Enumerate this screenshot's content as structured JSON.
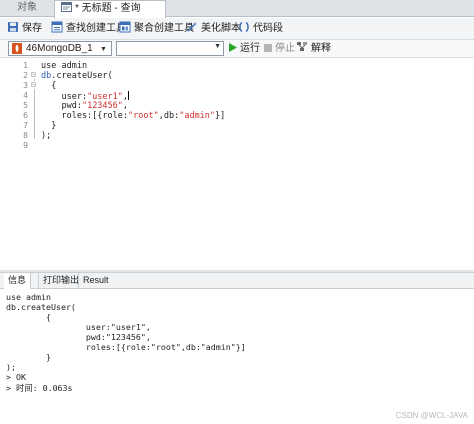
{
  "tabs": {
    "objects_label": "对象",
    "query_label": "* 无标题 - 查询"
  },
  "toolbar": {
    "save_label": "保存",
    "find_builder_label": "查找创建工具",
    "aggregate_builder_label": "聚合创建工具",
    "beautify_label": "美化脚本",
    "snippet_label": "代码段"
  },
  "selector": {
    "connection_value": "46MongoDB_1",
    "database_value": "",
    "run_label": "运行",
    "stop_label": "停止",
    "explain_label": "解释"
  },
  "editor": {
    "line_numbers": [
      "1",
      "2",
      "3",
      "4",
      "5",
      "6",
      "7",
      "8",
      "9"
    ],
    "lines": {
      "l1": "use admin",
      "l2_obj": "db",
      "l2_rest": ".createUser(",
      "l3": "  {",
      "l4_key": "    user:",
      "l4_val": "\"user1\"",
      "l4_comma": ",",
      "l5_key": "    pwd:",
      "l5_val": "\"123456\"",
      "l5_comma": ",",
      "l6_a": "    roles:[{role:",
      "l6_b": "\"root\"",
      "l6_c": ",db:",
      "l6_d": "\"admin\"",
      "l6_e": "}]",
      "l7": "  }",
      "l8": ");",
      "l9": ""
    }
  },
  "result_tabs": {
    "info_label": "信息",
    "print_label": "打印输出",
    "result_label": "Result"
  },
  "output": {
    "lines": [
      "use admin",
      "db.createUser(",
      "        {",
      "                user:\"user1\",",
      "                pwd:\"123456\",",
      "                roles:[{role:\"root\",db:\"admin\"}]",
      "        }",
      ");",
      "> OK",
      "> 时间: 0.063s"
    ]
  },
  "watermark": "CSDN @WCL-JAVA",
  "colors": {
    "keyword": "#2b5fb4",
    "string": "#d0312d",
    "run_green": "#2aa52a"
  }
}
